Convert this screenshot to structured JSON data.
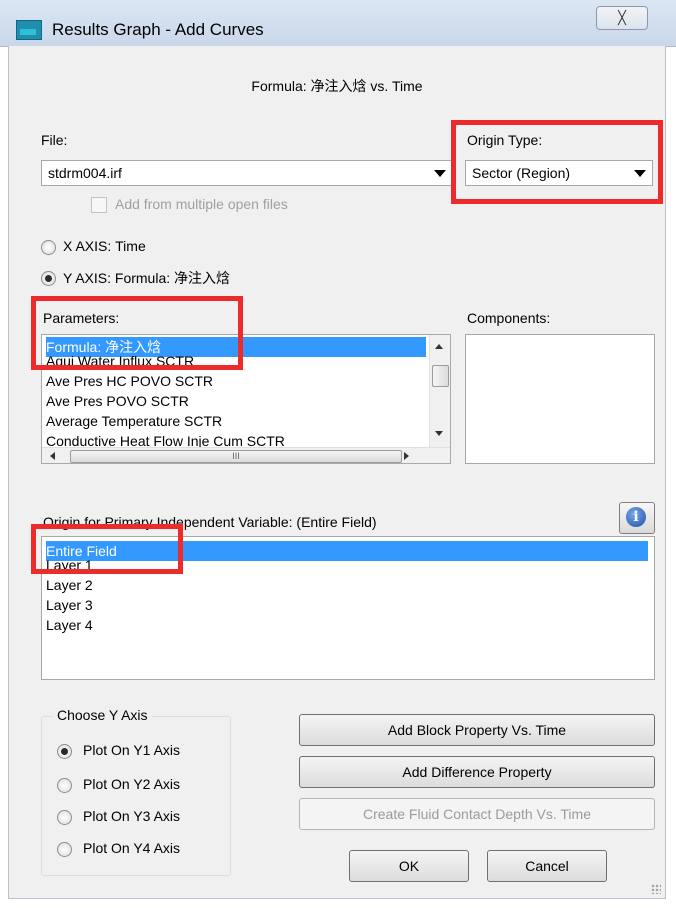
{
  "window": {
    "title": "Results Graph - Add Curves",
    "close_symbol": "╳"
  },
  "formula_title": "Formula: 净注入焓 vs. Time",
  "file": {
    "label": "File:",
    "value": "stdrm004.irf",
    "add_multiple_label": "Add from multiple open files"
  },
  "origin_type": {
    "label": "Origin Type:",
    "value": "Sector (Region)"
  },
  "x_axis": {
    "label": "X AXIS:",
    "value": "Time",
    "selected": false
  },
  "y_axis": {
    "label": "Y AXIS:",
    "value": "Formula: 净注入焓",
    "selected": true
  },
  "parameters": {
    "label": "Parameters:",
    "items": [
      "Formula: 净注入焓",
      "Aqui Water Influx SCTR",
      "Ave Pres HC POVO SCTR",
      "Ave Pres POVO SCTR",
      "Average Temperature SCTR",
      "Conductive Heat Flow Inje Cum SCTR"
    ],
    "selected_index": 0,
    "hscroll_glyph": "III"
  },
  "components": {
    "label": "Components:"
  },
  "origin_primary": {
    "label": "Origin for Primary Independent Variable: (Entire  Field)",
    "items": [
      "Entire  Field",
      "Layer 1",
      "Layer 2",
      "Layer 3",
      "Layer 4"
    ],
    "selected_index": 0
  },
  "choose_y_axis": {
    "label": "Choose Y Axis",
    "options": [
      "Plot On Y1 Axis",
      "Plot On Y2 Axis",
      "Plot On Y3 Axis",
      "Plot On Y4 Axis"
    ],
    "selected_index": 0
  },
  "buttons": {
    "add_block_property": "Add Block Property Vs. Time",
    "add_difference": "Add Difference Property",
    "create_fluid_contact": "Create Fluid Contact Depth Vs. Time",
    "ok": "OK",
    "cancel": "Cancel"
  },
  "icons": {
    "info": "info-icon",
    "highlight_color": "#ee2b2b",
    "selection_color": "#3399ff"
  }
}
